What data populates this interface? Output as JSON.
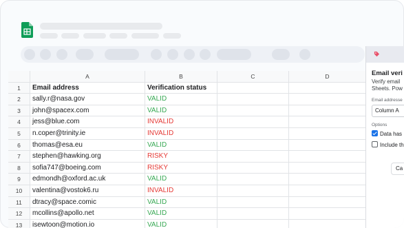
{
  "app": {
    "icon": "google-sheets-icon",
    "accent": "#0f9d58"
  },
  "grid": {
    "columns": [
      "A",
      "B",
      "C",
      "D"
    ],
    "rows": [
      {
        "num": "1",
        "email": "Email address",
        "status": "Verification status",
        "kind": "header"
      },
      {
        "num": "2",
        "email": "sally.r@nasa.gov",
        "status": "VALID",
        "kind": "valid"
      },
      {
        "num": "3",
        "email": "john@spacex.com",
        "status": "VALID",
        "kind": "valid"
      },
      {
        "num": "4",
        "email": "jess@blue.com",
        "status": "INVALID",
        "kind": "invalid"
      },
      {
        "num": "5",
        "email": "n.coper@trinity.ie",
        "status": "INVALID",
        "kind": "invalid"
      },
      {
        "num": "6",
        "email": "thomas@esa.eu",
        "status": "VALID",
        "kind": "valid"
      },
      {
        "num": "7",
        "email": "stephen@hawking.org",
        "status": "RISKY",
        "kind": "risky"
      },
      {
        "num": "8",
        "email": "sofia747@boeing.com",
        "status": "RISKY",
        "kind": "risky"
      },
      {
        "num": "9",
        "email": "edmondh@oxford.ac.uk",
        "status": "VALID",
        "kind": "valid"
      },
      {
        "num": "10",
        "email": "valentina@vostok6.ru",
        "status": "INVALID",
        "kind": "invalid"
      },
      {
        "num": "11",
        "email": "dtracy@space.comic",
        "status": "VALID",
        "kind": "valid"
      },
      {
        "num": "12",
        "email": "mcollins@apollo.net",
        "status": "VALID",
        "kind": "valid"
      },
      {
        "num": "13",
        "email": "isewtoon@motion.io",
        "status": "VALID",
        "kind": "valid"
      }
    ]
  },
  "status_colors": {
    "valid": "#36a852",
    "invalid": "#e53935",
    "risky": "#e53935"
  },
  "panel": {
    "logo": "addon-tag-icon",
    "title": "Email veri",
    "desc_line1": "Verify email",
    "desc_line2": "Sheets. Pow",
    "email_label": "Email addresse",
    "column_value": "Column A",
    "options_label": "Options",
    "opt1": "Data has",
    "opt2": "Include th",
    "cancel": "Ca"
  }
}
